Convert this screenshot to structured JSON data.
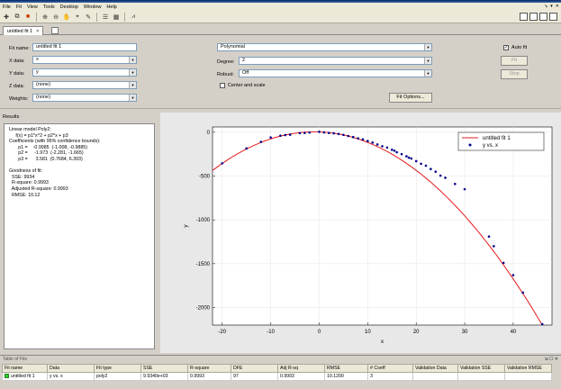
{
  "menu": [
    "File",
    "Fit",
    "View",
    "Tools",
    "Desktop",
    "Window",
    "Help"
  ],
  "tab": {
    "label": "untitled fit 1",
    "close": "×"
  },
  "left": {
    "fit_name_label": "Fit name:",
    "fit_name": "untitled fit 1",
    "x_label": "X data:",
    "x_value": "x",
    "y_label": "Y data:",
    "y_value": "y",
    "z_label": "Z data:",
    "z_value": "(none)",
    "w_label": "Weights:",
    "w_value": "(none)"
  },
  "mid": {
    "model": "Polynomial",
    "degree_label": "Degree:",
    "degree": "2",
    "robust_label": "Robust:",
    "robust": "Off",
    "center_label": "Center and scale",
    "fit_options": "Fit Options..."
  },
  "right": {
    "auto_fit": "Auto fit",
    "fit": "Fit",
    "stop": "Stop"
  },
  "results": {
    "header": "Results",
    "text": "Linear model Poly2:\n     f(x) = p1*x^2 + p2*x + p3\nCoefficients (with 95% confidence bounds):\n       p1 =    -0.9985  (-1.008, -0.9885)\n       p2 =     -1.973  (-2.281, -1.665)\n       p3 =      3.581  (0.7684, 6.393)\n\nGoodness of fit:\n  SSE: 9934\n  R-square: 0.9993\n  Adjusted R-square: 0.9993\n  RMSE: 10.12"
  },
  "chart_data": {
    "type": "scatter",
    "xlabel": "x",
    "ylabel": "y",
    "xlim": [
      -22,
      48
    ],
    "ylim": [
      -2200,
      60
    ],
    "xticks": [
      -20,
      -10,
      0,
      10,
      20,
      30,
      40
    ],
    "yticks": [
      0,
      -500,
      -1000,
      -1500,
      -2000
    ],
    "legend": {
      "placement": "top-right",
      "fit_name": "untitled fit 1",
      "data_name": "y vs. x"
    },
    "fit": {
      "p1": -0.9985,
      "p2": -1.973,
      "p3": 3.581,
      "x_range": [
        -22,
        48
      ],
      "color": "#e41a1c"
    },
    "points": [
      [
        -20,
        -355
      ],
      [
        -15,
        -185
      ],
      [
        -12,
        -110
      ],
      [
        -10,
        -60
      ],
      [
        -8,
        -40
      ],
      [
        -7,
        -32
      ],
      [
        -6,
        -28
      ],
      [
        -4,
        -10
      ],
      [
        -3,
        -8
      ],
      [
        -2,
        -3
      ],
      [
        0,
        5
      ],
      [
        1,
        -2
      ],
      [
        2,
        -8
      ],
      [
        3,
        -12
      ],
      [
        4,
        -20
      ],
      [
        5,
        -30
      ],
      [
        6,
        -43
      ],
      [
        7,
        -55
      ],
      [
        8,
        -70
      ],
      [
        9,
        -82
      ],
      [
        10,
        -100
      ],
      [
        11,
        -118
      ],
      [
        12,
        -140
      ],
      [
        13,
        -160
      ],
      [
        14,
        -175
      ],
      [
        15,
        -200
      ],
      [
        15.5,
        -210
      ],
      [
        16,
        -228
      ],
      [
        17,
        -250
      ],
      [
        18,
        -275
      ],
      [
        18.5,
        -290
      ],
      [
        19,
        -300
      ],
      [
        20,
        -330
      ],
      [
        21,
        -360
      ],
      [
        22,
        -382
      ],
      [
        23,
        -420
      ],
      [
        24,
        -450
      ],
      [
        25,
        -495
      ],
      [
        26,
        -520
      ],
      [
        28,
        -590
      ],
      [
        30,
        -650
      ],
      [
        35,
        -1190
      ],
      [
        36,
        -1300
      ],
      [
        38,
        -1490
      ],
      [
        40,
        -1630
      ],
      [
        42,
        -1830
      ],
      [
        46,
        -2190
      ]
    ],
    "point_color": "#00008b"
  },
  "table": {
    "title": "Table of Fits",
    "columns": [
      "Fit name",
      "Data",
      "Fit type",
      "SSE",
      "R-square",
      "DFE",
      "Adj R-sq",
      "RMSE",
      "# Coeff",
      "Validation Data",
      "Validation SSE",
      "Validation RMSE"
    ],
    "rows": [
      [
        "untitled fit 1",
        "y vs. x",
        "poly2",
        "9.9340e+03",
        "0.9993",
        "97",
        "0.9993",
        "10.1200",
        "3",
        "",
        "",
        ""
      ]
    ]
  }
}
